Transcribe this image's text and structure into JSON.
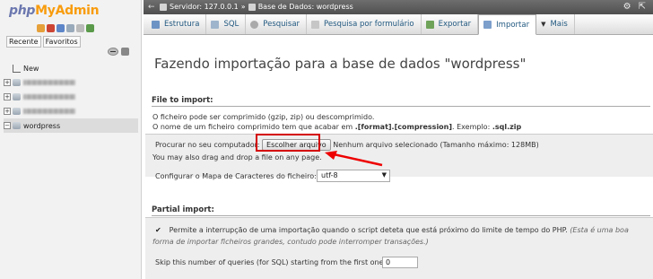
{
  "sidebar": {
    "logo": {
      "php": "php",
      "my": "My",
      "admin": "Admin"
    },
    "tabs": [
      "Recente",
      "Favoritos"
    ],
    "tree": [
      {
        "label": "New",
        "type": "new"
      },
      {
        "label": "",
        "type": "blurred"
      },
      {
        "label": "",
        "type": "blurred"
      },
      {
        "label": "",
        "type": "blurred"
      },
      {
        "label": "wordpress",
        "type": "db",
        "active": true
      }
    ]
  },
  "topbar": {
    "server": "Servidor: 127.0.0.1",
    "separator": "»",
    "database": "Base de Dados: wordpress"
  },
  "menu": {
    "tabs": [
      {
        "label": "Estrutura",
        "icon": "structure-icon"
      },
      {
        "label": "SQL",
        "icon": "sql-icon"
      },
      {
        "label": "Pesquisar",
        "icon": "search-icon"
      },
      {
        "label": "Pesquisa por formulário",
        "icon": "query-icon"
      },
      {
        "label": "Exportar",
        "icon": "export-icon"
      },
      {
        "label": "Importar",
        "icon": "import-icon",
        "active": true
      },
      {
        "label": "Mais",
        "icon": "more-icon"
      }
    ]
  },
  "main": {
    "title": "Fazendo importação para a base de dados \"wordpress\"",
    "file_section": {
      "heading": "File to import:",
      "compress_line": "O ficheiro pode ser comprimido (gzip, zip) ou descomprimido.",
      "name_line_pre": "O nome de um ficheiro comprimido tem que acabar em",
      "name_line_bold": ".[format].[compression]",
      "name_line_mid": ". Exemplo:",
      "name_line_example": ".sql.zip",
      "browse_label": "Procurar no seu computador:",
      "browse_button": "Escolher arquivo",
      "no_file": "Nenhum arquivo selecionado (Tamanho máximo: 128MB)",
      "drag_drop": "You may also drag and drop a file on any page.",
      "charset_label": "Configurar o Mapa de Caracteres do ficheiro:",
      "charset_value": "utf-8"
    },
    "partial_section": {
      "heading": "Partial import:",
      "check_mark": "✔",
      "interrupt_text": "Permite a interrupção de uma importação quando o script deteta que está próximo do limite de tempo do PHP.",
      "interrupt_note_1": "(Esta é uma boa",
      "interrupt_note_2": "forma de importar ficheiros grandes, contudo pode interromper transações.)",
      "skip_label": "Skip this number of queries (for SQL) starting from the first one:",
      "skip_value": "0"
    }
  },
  "colors": {
    "highlight": "#d40000",
    "link": "#235a81"
  }
}
